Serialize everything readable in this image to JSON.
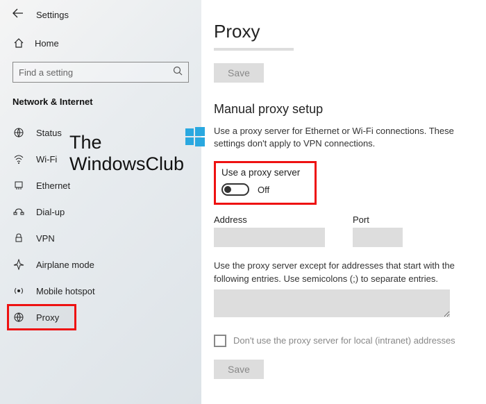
{
  "header": {
    "title": "Settings"
  },
  "home": {
    "label": "Home"
  },
  "search": {
    "placeholder": "Find a setting"
  },
  "category": {
    "title": "Network & Internet"
  },
  "sidebar": {
    "items": [
      {
        "label": "Status"
      },
      {
        "label": "Wi-Fi"
      },
      {
        "label": "Ethernet"
      },
      {
        "label": "Dial-up"
      },
      {
        "label": "VPN"
      },
      {
        "label": "Airplane mode"
      },
      {
        "label": "Mobile hotspot"
      },
      {
        "label": "Proxy"
      }
    ]
  },
  "main": {
    "title": "Proxy",
    "save1": "Save",
    "section_title": "Manual proxy setup",
    "section_desc": "Use a proxy server for Ethernet or Wi-Fi connections. These settings don't apply to VPN connections.",
    "toggle_label": "Use a proxy server",
    "toggle_state": "Off",
    "address_label": "Address",
    "port_label": "Port",
    "except_desc": "Use the proxy server except for addresses that start with the following entries. Use semicolons (;) to separate entries.",
    "local_checkbox": "Don't use the proxy server for local (intranet) addresses",
    "save2": "Save"
  },
  "watermark": {
    "line1": "The",
    "line2": "WindowsClub"
  }
}
